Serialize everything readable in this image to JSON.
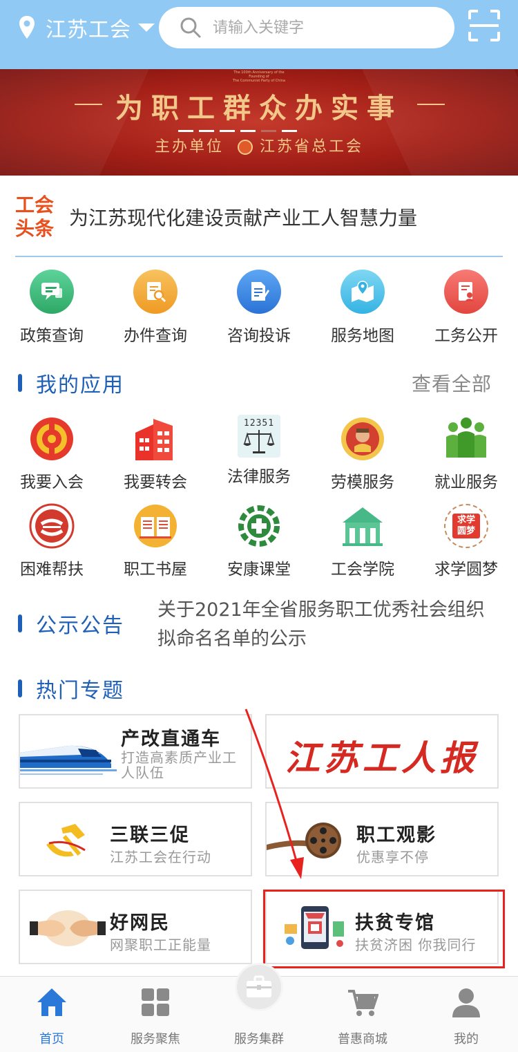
{
  "header": {
    "location": "江苏工会",
    "search_placeholder": "请输入关键字"
  },
  "banner": {
    "tiny_line1": "The 100th Anniversary of the Founding of",
    "tiny_line2": "The Communist Party of China",
    "slogan": "为职工群众办实事",
    "host_label": "主办单位",
    "host_name": "江苏省总工会"
  },
  "headline": {
    "tag_line1": "工会",
    "tag_line2": "头条",
    "text": "为江苏现代化建设贡献产业工人智慧力量"
  },
  "quick_items": [
    {
      "label": "政策查询",
      "icon": "chat-icon",
      "color": "#3cb878"
    },
    {
      "label": "办件查询",
      "icon": "doc-search-icon",
      "color": "#f2a93b"
    },
    {
      "label": "咨询投诉",
      "icon": "edit-doc-icon",
      "color": "#3a86e6"
    },
    {
      "label": "服务地图",
      "icon": "map-icon",
      "color": "#4cc0e8"
    },
    {
      "label": "工务公开",
      "icon": "public-doc-icon",
      "color": "#ef5350"
    }
  ],
  "my_apps": {
    "title": "我的应用",
    "view_all": "查看全部",
    "items": [
      {
        "label": "我要入会",
        "icon": "union-emblem-icon"
      },
      {
        "label": "我要转会",
        "icon": "building-icon"
      },
      {
        "label": "法律服务",
        "icon": "scales-icon",
        "badge": "12351"
      },
      {
        "label": "劳模服务",
        "icon": "model-worker-icon"
      },
      {
        "label": "就业服务",
        "icon": "people-group-icon"
      },
      {
        "label": "困难帮扶",
        "icon": "help-emblem-icon"
      },
      {
        "label": "职工书屋",
        "icon": "book-icon"
      },
      {
        "label": "安康课堂",
        "icon": "health-gear-icon"
      },
      {
        "label": "工会学院",
        "icon": "academy-icon"
      },
      {
        "label": "求学圆梦",
        "icon": "study-dream-icon",
        "badge": "求学圆梦"
      }
    ]
  },
  "notice": {
    "title": "公示公告",
    "text": "关于2021年全省服务职工优秀社会组织拟命名名单的公示"
  },
  "topics": {
    "title": "热门专题",
    "cards": [
      {
        "title": "产改直通车",
        "subtitle": "打造高素质产业工人队伍",
        "icon": "train-icon"
      },
      {
        "title": "江苏工人报",
        "subtitle": "",
        "icon": "newspaper-logo"
      },
      {
        "title": "三联三促",
        "subtitle": "江苏工会在行动",
        "icon": "party-emblem-icon"
      },
      {
        "title": "职工观影",
        "subtitle": "优惠享不停",
        "icon": "film-reel-icon"
      },
      {
        "title": "好网民",
        "subtitle": "网聚职工正能量",
        "icon": "fist-bump-icon"
      },
      {
        "title": "扶贫专馆",
        "subtitle": "扶贫济困 你我同行",
        "icon": "shopping-phone-icon"
      }
    ]
  },
  "tabbar": [
    {
      "label": "首页",
      "icon": "home-icon",
      "active": true
    },
    {
      "label": "服务聚焦",
      "icon": "grid-icon"
    },
    {
      "label": "服务集群",
      "icon": "briefcase-icon"
    },
    {
      "label": "普惠商城",
      "icon": "cart-icon"
    },
    {
      "label": "我的",
      "icon": "user-icon"
    }
  ],
  "colors": {
    "header_bg": "#8fc9f4",
    "accent_blue": "#1e5fb8",
    "accent_orange": "#e8501e",
    "highlight_red": "#e8221e"
  }
}
